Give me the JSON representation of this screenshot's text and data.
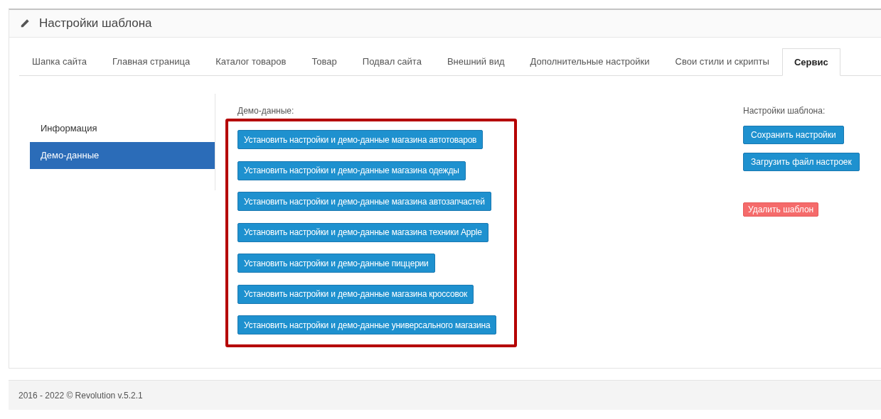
{
  "panel": {
    "title": "Настройки шаблона"
  },
  "tabs": [
    {
      "label": "Шапка сайта",
      "selected": false
    },
    {
      "label": "Главная страница",
      "selected": false
    },
    {
      "label": "Каталог товаров",
      "selected": false
    },
    {
      "label": "Товар",
      "selected": false
    },
    {
      "label": "Подвал сайта",
      "selected": false
    },
    {
      "label": "Внешний вид",
      "selected": false
    },
    {
      "label": "Дополнительные настройки",
      "selected": false
    },
    {
      "label": "Свои стили и скрипты",
      "selected": false
    },
    {
      "label": "Сервис",
      "selected": true
    }
  ],
  "sidebar": {
    "items": [
      {
        "label": "Информация",
        "selected": false
      },
      {
        "label": "Демо-данные",
        "selected": true
      }
    ]
  },
  "demo": {
    "label": "Демо-данные:",
    "highlighted": true,
    "buttons": [
      "Установить настройки и демо-данные магазина автотоваров",
      "Установить настройки и демо-данные магазина одежды",
      "Установить настройки и демо-данные магазина автозапчастей",
      "Установить настройки и демо-данные магазина техники Apple",
      "Установить настройки и демо-данные пиццерии",
      "Установить настройки и демо-данные магазина кроссовок",
      "Установить настройки и демо-данные универсального магазина"
    ]
  },
  "template_settings": {
    "label": "Настройки шаблона:",
    "buttons": [
      {
        "label": "Сохранить настройки",
        "kind": "primary"
      },
      {
        "label": "Загрузить файл настроек",
        "kind": "primary"
      },
      {
        "label": "Удалить шаблон",
        "kind": "danger"
      }
    ]
  },
  "footer": {
    "text": "2016 - 2022 © Revolution v.5.2.1"
  }
}
